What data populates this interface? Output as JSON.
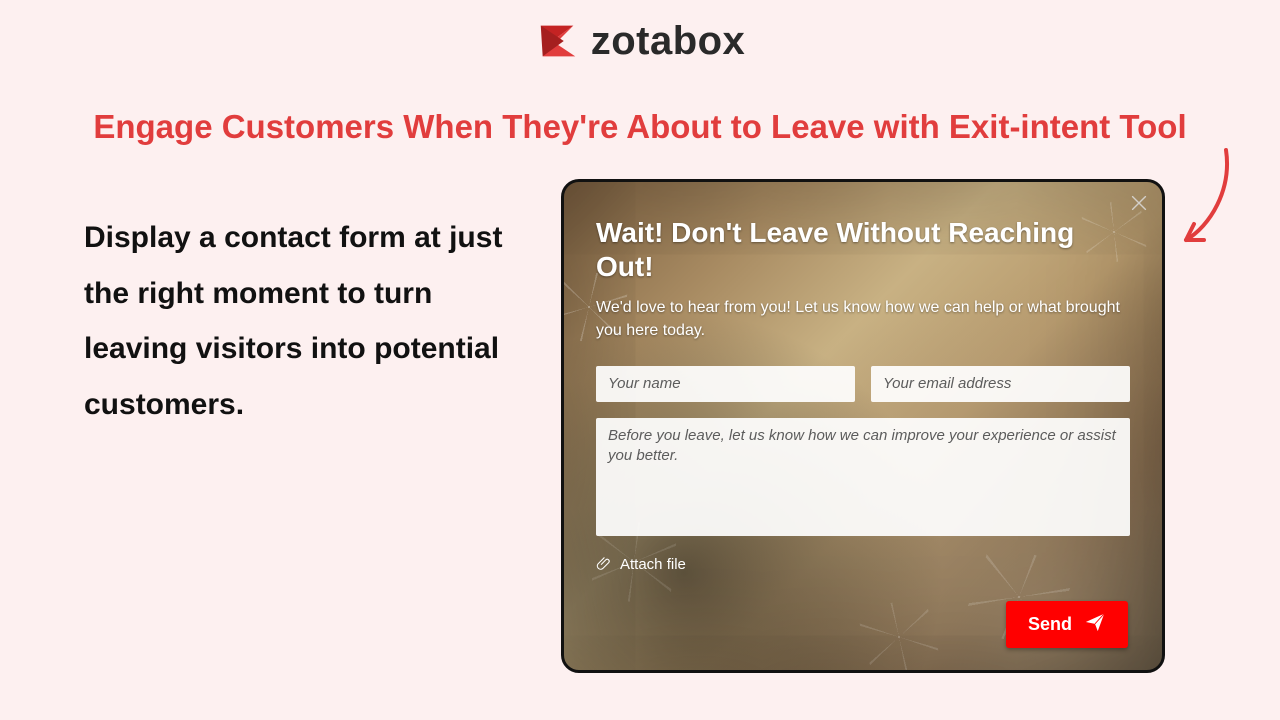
{
  "brand": {
    "name": "zotabox"
  },
  "headline": "Engage Customers When They're About to Leave with Exit-intent Tool",
  "description": "Display a contact form at just the right moment to turn leaving visitors into potential customers.",
  "popup": {
    "title": "Wait! Don't Leave Without Reaching Out!",
    "subtitle": "We'd love to hear from you! Let us know how we can help or what brought you here today.",
    "name_placeholder": "Your name",
    "email_placeholder": "Your email address",
    "message_placeholder": "Before you leave, let us know how we can improve your experience or assist you better.",
    "attach_label": "Attach file",
    "send_label": "Send"
  }
}
